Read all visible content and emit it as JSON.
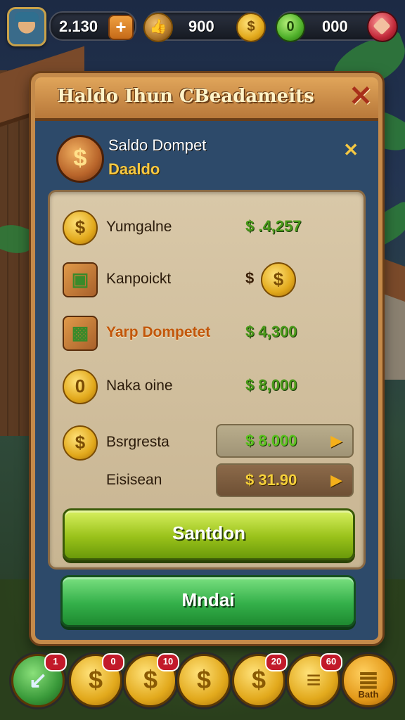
{
  "hud": {
    "resource_1": "2.130",
    "plus_symbol": "+",
    "resource_2": "900",
    "resource_3": "000",
    "coin_symbol": "$"
  },
  "panel": {
    "title": "Haldo Ihun CBeadameits",
    "close_symbol": "✕",
    "wallet_title": "Saldo Dompet",
    "wallet_subtitle": "Daaldo",
    "mini_close_symbol": "✕"
  },
  "rows": [
    {
      "label": "Yumgalne",
      "value": "$ .4,257",
      "icon": "coin-icon"
    },
    {
      "label": "Kanpoickt",
      "value": "$",
      "icon": "chest-icon"
    },
    {
      "label": "Yarp Dompetet",
      "value": "$ 4,300",
      "icon": "box-icon"
    },
    {
      "label": "Naka oine",
      "value": "$ 8,000",
      "icon": "coin-icon"
    },
    {
      "label": "Bsrgresta",
      "value": "$ 8.000",
      "icon": "coin-icon"
    },
    {
      "label": "Eisisean",
      "value": "$ 31.90",
      "icon": "none"
    }
  ],
  "pill_arrow": "▶",
  "buttons": {
    "primary": "Santdon",
    "secondary": "Mndai"
  },
  "bottom_bar": [
    {
      "badge": "1",
      "icon": "arrow-icon"
    },
    {
      "badge": "0",
      "icon": "coin-icon"
    },
    {
      "badge": "10",
      "icon": "coin-icon"
    },
    {
      "badge": "",
      "icon": "coin-icon"
    },
    {
      "badge": "20",
      "icon": "coin-icon"
    },
    {
      "badge": "60",
      "icon": "coin-stack-icon"
    },
    {
      "badge": "",
      "label": "Bath",
      "icon": "coin-chest-icon"
    }
  ],
  "colors": {
    "accent_gold": "#f5c842",
    "value_green": "#5ac21e",
    "panel_blue": "#2d4a6a",
    "frame_brown": "#c48a4a"
  }
}
